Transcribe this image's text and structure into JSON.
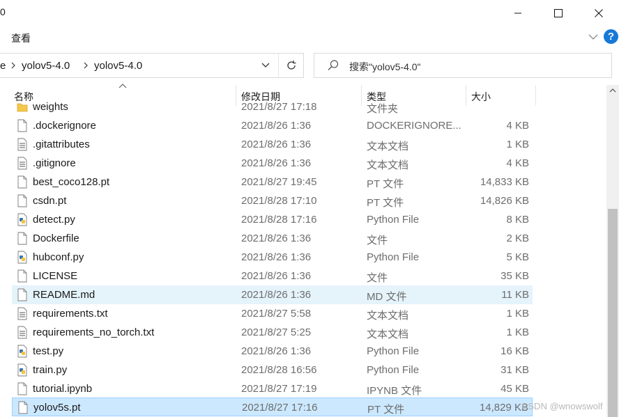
{
  "window": {
    "title_fragment": "0"
  },
  "ribbon": {
    "view_tab": "查看",
    "help": "?"
  },
  "address": {
    "prefix_fragment": "e",
    "crumbs": [
      "yolov5-4.0",
      "yolov5-4.0"
    ]
  },
  "search": {
    "placeholder": "搜索\"yolov5-4.0\""
  },
  "columns": {
    "name": "名称",
    "date": "修改日期",
    "type": "类型",
    "size": "大小"
  },
  "files": [
    {
      "name": "weights",
      "date": "2021/8/27 17:18",
      "type": "文件夹",
      "size": "",
      "icon": "folder-icon",
      "state": "partial"
    },
    {
      "name": ".dockerignore",
      "date": "2021/8/26 1:36",
      "type": "DOCKERIGNORE...",
      "size": "4 KB",
      "icon": "file-icon",
      "state": ""
    },
    {
      "name": ".gitattributes",
      "date": "2021/8/26 1:36",
      "type": "文本文档",
      "size": "1 KB",
      "icon": "text-file-icon",
      "state": ""
    },
    {
      "name": ".gitignore",
      "date": "2021/8/26 1:36",
      "type": "文本文档",
      "size": "4 KB",
      "icon": "text-file-icon",
      "state": ""
    },
    {
      "name": "best_coco128.pt",
      "date": "2021/8/27 19:45",
      "type": "PT 文件",
      "size": "14,833 KB",
      "icon": "file-icon",
      "state": ""
    },
    {
      "name": "csdn.pt",
      "date": "2021/8/28 17:10",
      "type": "PT 文件",
      "size": "14,826 KB",
      "icon": "file-icon",
      "state": ""
    },
    {
      "name": "detect.py",
      "date": "2021/8/28 17:16",
      "type": "Python File",
      "size": "8 KB",
      "icon": "python-file-icon",
      "state": ""
    },
    {
      "name": "Dockerfile",
      "date": "2021/8/26 1:36",
      "type": "文件",
      "size": "2 KB",
      "icon": "file-icon",
      "state": ""
    },
    {
      "name": "hubconf.py",
      "date": "2021/8/26 1:36",
      "type": "Python File",
      "size": "5 KB",
      "icon": "python-file-icon",
      "state": ""
    },
    {
      "name": "LICENSE",
      "date": "2021/8/26 1:36",
      "type": "文件",
      "size": "35 KB",
      "icon": "file-icon",
      "state": ""
    },
    {
      "name": "README.md",
      "date": "2021/8/26 1:36",
      "type": "MD 文件",
      "size": "11 KB",
      "icon": "file-icon",
      "state": "hover"
    },
    {
      "name": "requirements.txt",
      "date": "2021/8/27 5:58",
      "type": "文本文档",
      "size": "1 KB",
      "icon": "text-file-icon",
      "state": ""
    },
    {
      "name": "requirements_no_torch.txt",
      "date": "2021/8/27 5:25",
      "type": "文本文档",
      "size": "1 KB",
      "icon": "text-file-icon",
      "state": ""
    },
    {
      "name": "test.py",
      "date": "2021/8/26 1:36",
      "type": "Python File",
      "size": "16 KB",
      "icon": "python-file-icon",
      "state": ""
    },
    {
      "name": "train.py",
      "date": "2021/8/28 16:56",
      "type": "Python File",
      "size": "31 KB",
      "icon": "python-file-icon",
      "state": ""
    },
    {
      "name": "tutorial.ipynb",
      "date": "2021/8/27 17:19",
      "type": "IPYNB 文件",
      "size": "45 KB",
      "icon": "file-icon",
      "state": ""
    },
    {
      "name": "yolov5s.pt",
      "date": "2021/8/27 17:16",
      "type": "PT 文件",
      "size": "14,829 KB",
      "icon": "file-icon",
      "state": "selected"
    }
  ],
  "watermark": "CSDN @wnowswolf"
}
